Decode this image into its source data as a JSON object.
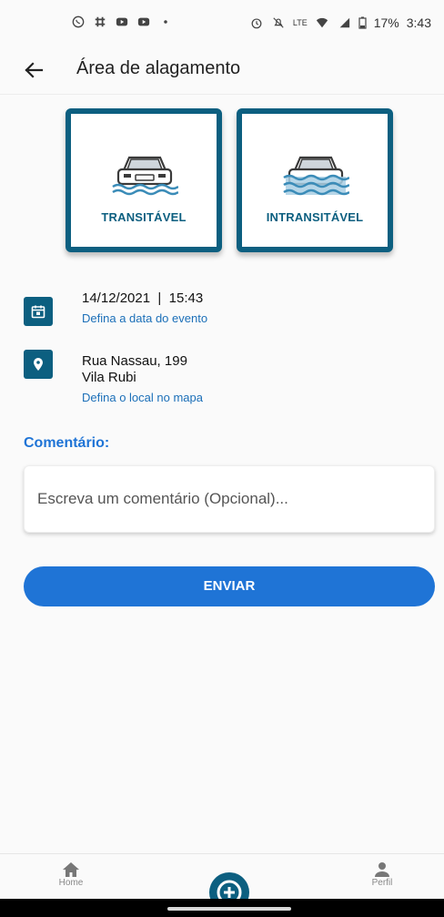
{
  "status_bar": {
    "battery": "17%",
    "time": "3:43",
    "lte_label": "LTE"
  },
  "header": {
    "title": "Área de alagamento"
  },
  "road_options": [
    {
      "label": "TRANSITÁVEL",
      "icon": "car-water-icon"
    },
    {
      "label": "INTRANSITÁVEL",
      "icon": "car-flooded-icon"
    }
  ],
  "event": {
    "date": "14/12/2021",
    "time": "15:43",
    "separator": "|",
    "date_link": "Defina a data do evento"
  },
  "location": {
    "street": "Rua Nassau, 199",
    "district": "Vila Rubi",
    "map_link": "Defina o local no mapa"
  },
  "comment": {
    "label": "Comentário:",
    "placeholder": "Escreva um comentário (Opcional)..."
  },
  "submit": {
    "label": "ENVIAR"
  },
  "bottom_nav": {
    "home_label": "Home",
    "profile_label": "Perfil"
  },
  "colors": {
    "primary_dark": "#0c5f80",
    "accent_blue": "#1f74d6",
    "link_blue": "#1b6fb8"
  }
}
